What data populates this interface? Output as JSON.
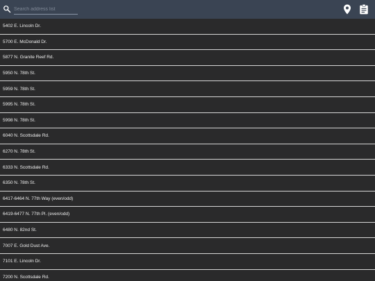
{
  "header": {
    "search_placeholder": "Search address list",
    "icons": [
      "search-icon",
      "map-pin-icon",
      "clipboard-icon"
    ],
    "accent_color": "#3a4453"
  },
  "addresses": [
    "5402 E. Lincoln Dr.",
    "5700 E. McDonald Dr.",
    "5877 N. Granite Reef Rd.",
    "5950 N. 78th St.",
    "5959 N. 78th St.",
    "5995 N. 78th St.",
    "5998 N. 78th St.",
    "6040 N. Scottsdale Rd.",
    "6270 N. 78th St.",
    "6333 N. Scottsdale Rd.",
    "6350 N. 78th St.",
    "6417-6464 N. 77th Way (even/odd)",
    "6419-6477 N. 77th Pl. (even/odd)",
    "6480 N. 82nd St.",
    "7007 E. Gold Dust Ave.",
    "7101 E. Lincoln Dr.",
    "7200 N. Scottsdale Rd."
  ]
}
